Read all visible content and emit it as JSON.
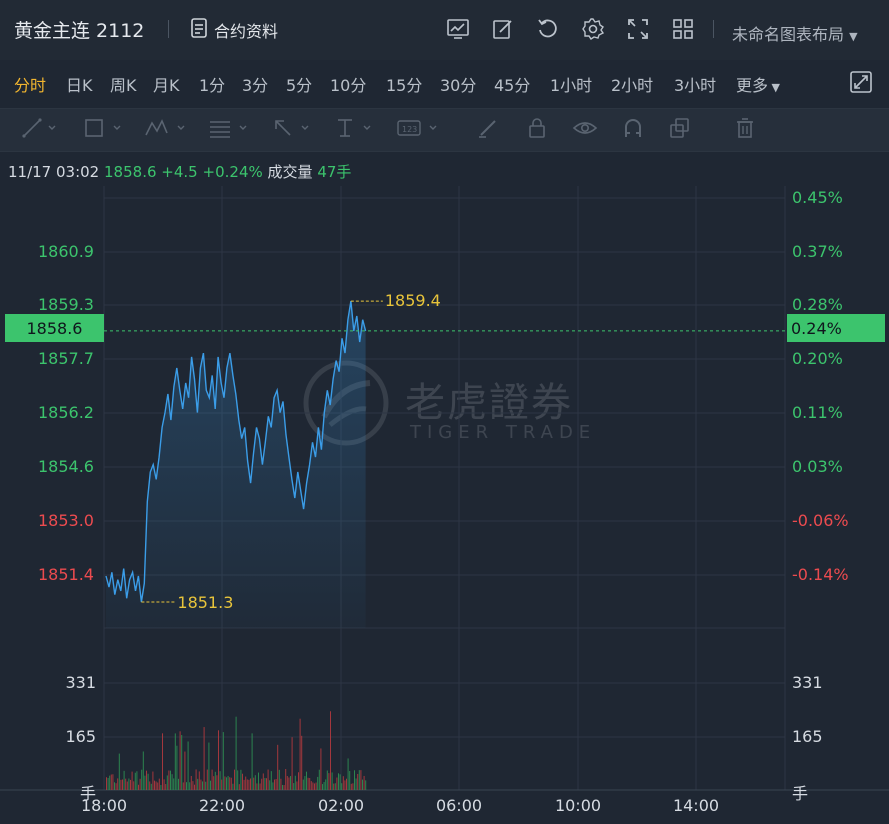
{
  "header": {
    "title": "黄金主连 2112",
    "contract_label": "合约资料",
    "layout_label": "未命名图表布局"
  },
  "periods": [
    "分时",
    "日K",
    "周K",
    "月K",
    "1分",
    "3分",
    "5分",
    "10分",
    "15分",
    "30分",
    "45分",
    "1小时",
    "2小时",
    "3小时",
    "更多"
  ],
  "active_period": "分时",
  "info": {
    "datetime": "11/17 03:02",
    "price": "1858.6",
    "change": "+4.5",
    "change_pct": "+0.24%",
    "volume_label": "成交量",
    "volume": "47手"
  },
  "price_axis": [
    "1860.9",
    "1859.3",
    "1857.7",
    "1856.2",
    "1854.6",
    "1853.0",
    "1851.4"
  ],
  "pct_axis": [
    "0.45%",
    "0.37%",
    "0.28%",
    "0.20%",
    "0.11%",
    "0.03%",
    "-0.06%",
    "-0.14%"
  ],
  "current": {
    "price": "1858.6",
    "pct": "0.24%"
  },
  "high_marker": "1859.4",
  "low_marker": "1851.3",
  "volume_axis": [
    "331",
    "165",
    "手"
  ],
  "volume_axis_right": [
    "331",
    "165",
    "手"
  ],
  "time_axis": [
    "18:00",
    "22:00",
    "02:00",
    "06:00",
    "10:00",
    "14:00"
  ],
  "watermark": {
    "cn": "老虎證券",
    "en": "TIGER TRADE"
  },
  "colors": {
    "up": "#3cc46d",
    "down": "#ec4b4f",
    "line": "#3b9de8",
    "accent": "#f1b52f",
    "marker": "#e8c43b"
  },
  "chart_data": {
    "type": "line",
    "x_start": "18:00",
    "x_ticks": [
      "18:00",
      "22:00",
      "02:00",
      "06:00",
      "10:00",
      "14:00"
    ],
    "ylim": [
      1850.6,
      1862.5
    ],
    "prev_close": 1854.1,
    "series": [
      {
        "values": [
          1852.0,
          1851.7,
          1852.1,
          1851.5,
          1851.9,
          1851.6,
          1852.2,
          1851.4,
          1851.9,
          1852.1,
          1851.6,
          1852.0,
          1851.3,
          1851.8,
          1854.0,
          1854.8,
          1855.0,
          1854.6,
          1855.2,
          1856.0,
          1856.4,
          1856.9,
          1856.2,
          1857.1,
          1857.6,
          1857.0,
          1856.5,
          1857.2,
          1856.8,
          1857.9,
          1857.3,
          1856.4,
          1857.6,
          1858.0,
          1857.0,
          1856.8,
          1857.4,
          1856.5,
          1857.9,
          1857.2,
          1856.8,
          1857.6,
          1858.0,
          1857.4,
          1856.9,
          1856.2,
          1855.7,
          1856.0,
          1855.1,
          1854.5,
          1855.3,
          1856.0,
          1855.7,
          1855.0,
          1855.6,
          1856.3,
          1856.0,
          1856.8,
          1857.0,
          1856.4,
          1856.7,
          1855.8,
          1855.2,
          1854.6,
          1854.1,
          1854.8,
          1854.3,
          1853.8,
          1854.5,
          1855.0,
          1855.6,
          1855.2,
          1856.0,
          1855.4,
          1856.4,
          1857.0,
          1856.6,
          1857.3,
          1857.8,
          1857.5,
          1858.4,
          1858.0,
          1858.9,
          1859.4,
          1858.6,
          1859.0,
          1858.3,
          1858.9,
          1858.6
        ]
      }
    ],
    "volume": {
      "ylabel": "手",
      "ticks": [
        165,
        331
      ]
    }
  }
}
